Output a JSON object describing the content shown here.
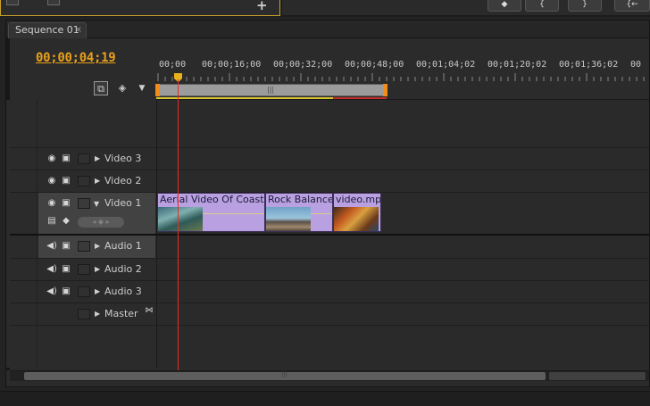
{
  "sequence_tab": {
    "label": "Sequence 01",
    "close": "×"
  },
  "timecode": "00;00;04;19",
  "ruler": {
    "labels": [
      "00;00",
      "00;00;16;00",
      "00;00;32;00",
      "00;00;48;00",
      "00;01;04;02",
      "00;01;20;02",
      "00;01;36;02",
      "00"
    ]
  },
  "tracks": {
    "video3": "Video 3",
    "video2": "Video 2",
    "video1": "Video 1",
    "audio1": "Audio 1",
    "audio2": "Audio 2",
    "audio3": "Audio 3",
    "master": "Master"
  },
  "clips": {
    "clip1": "Aerial Video Of Coastli",
    "clip2": "Rock Balance",
    "clip3": "video.mp"
  },
  "colors": {
    "timecode": "#e8a01c",
    "clip": "#b9a0e0",
    "playhead": "#e0302a",
    "work_area_handle": "#f08c19",
    "panel_border_accent": "#c9a227"
  },
  "icons": {
    "eye": "eye-icon",
    "film": "filmstrip-icon",
    "speaker": "speaker-icon",
    "expand": "expand-triangle-icon",
    "snap": "snap-icon",
    "marker": "add-marker-icon"
  }
}
